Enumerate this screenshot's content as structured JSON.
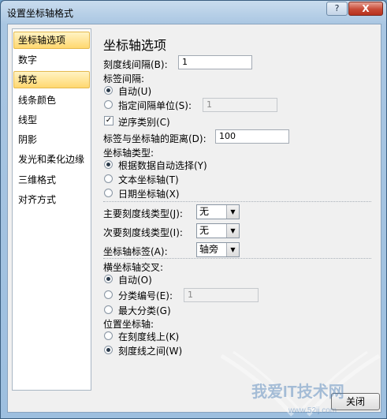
{
  "window": {
    "title": "设置坐标轴格式",
    "help_label": "?",
    "close_label": "X"
  },
  "sidebar": {
    "items": [
      {
        "label": "坐标轴选项",
        "selected": true
      },
      {
        "label": "数字",
        "selected": false
      },
      {
        "label": "填充",
        "selected": true
      },
      {
        "label": "线条颜色",
        "selected": false
      },
      {
        "label": "线型",
        "selected": false
      },
      {
        "label": "阴影",
        "selected": false
      },
      {
        "label": "发光和柔化边缘",
        "selected": false
      },
      {
        "label": "三维格式",
        "selected": false
      },
      {
        "label": "对齐方式",
        "selected": false
      }
    ]
  },
  "panel": {
    "title": "坐标轴选项",
    "tick_interval_label": "刻度线间隔(B):",
    "tick_interval_value": "1",
    "label_interval_heading": "标签间隔:",
    "auto_label": "自动(U)",
    "auto_selected": true,
    "specify_label": "指定间隔单位(S):",
    "specify_value": "1",
    "reverse_label": "逆序类别(C)",
    "reverse_checked": true,
    "label_distance_label": "标签与坐标轴的距离(D):",
    "label_distance_value": "100",
    "axis_type_heading": "坐标轴类型:",
    "axis_type_auto": "根据数据自动选择(Y)",
    "axis_type_text": "文本坐标轴(T)",
    "axis_type_date": "日期坐标轴(X)",
    "major_tick_label": "主要刻度线类型(J):",
    "major_tick_value": "无",
    "minor_tick_label": "次要刻度线类型(I):",
    "minor_tick_value": "无",
    "axis_labels_label": "坐标轴标签(A):",
    "axis_labels_value": "轴旁",
    "cross_heading": "横坐标轴交叉:",
    "cross_auto": "自动(O)",
    "cross_category_label": "分类编号(E):",
    "cross_category_value": "1",
    "cross_max": "最大分类(G)",
    "position_heading": "位置坐标轴:",
    "position_on_tick": "在刻度线上(K)",
    "position_between": "刻度线之间(W)"
  },
  "footer": {
    "close_label": "关闭"
  },
  "watermark": {
    "text": "我爱IT技术网",
    "url": "www.52ij.com"
  },
  "colors": {
    "selection_fill": "#ffd870",
    "client_bg": "#f0f0f0",
    "frame": "#a9c6e2"
  }
}
